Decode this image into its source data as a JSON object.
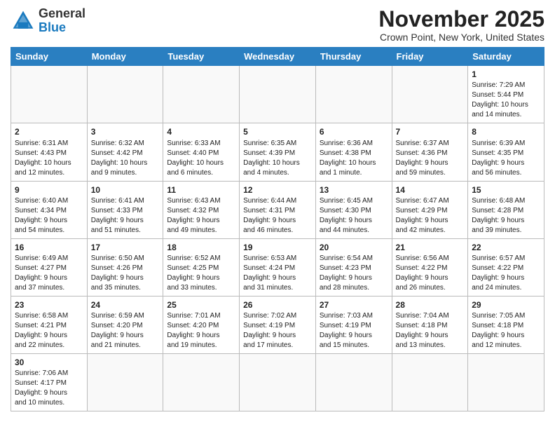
{
  "logo": {
    "text_general": "General",
    "text_blue": "Blue"
  },
  "title": {
    "month_year": "November 2025",
    "location": "Crown Point, New York, United States"
  },
  "weekdays": [
    "Sunday",
    "Monday",
    "Tuesday",
    "Wednesday",
    "Thursday",
    "Friday",
    "Saturday"
  ],
  "weeks": [
    [
      {
        "day": "",
        "info": ""
      },
      {
        "day": "",
        "info": ""
      },
      {
        "day": "",
        "info": ""
      },
      {
        "day": "",
        "info": ""
      },
      {
        "day": "",
        "info": ""
      },
      {
        "day": "",
        "info": ""
      },
      {
        "day": "1",
        "info": "Sunrise: 7:29 AM\nSunset: 5:44 PM\nDaylight: 10 hours\nand 14 minutes."
      }
    ],
    [
      {
        "day": "2",
        "info": "Sunrise: 6:31 AM\nSunset: 4:43 PM\nDaylight: 10 hours\nand 12 minutes."
      },
      {
        "day": "3",
        "info": "Sunrise: 6:32 AM\nSunset: 4:42 PM\nDaylight: 10 hours\nand 9 minutes."
      },
      {
        "day": "4",
        "info": "Sunrise: 6:33 AM\nSunset: 4:40 PM\nDaylight: 10 hours\nand 6 minutes."
      },
      {
        "day": "5",
        "info": "Sunrise: 6:35 AM\nSunset: 4:39 PM\nDaylight: 10 hours\nand 4 minutes."
      },
      {
        "day": "6",
        "info": "Sunrise: 6:36 AM\nSunset: 4:38 PM\nDaylight: 10 hours\nand 1 minute."
      },
      {
        "day": "7",
        "info": "Sunrise: 6:37 AM\nSunset: 4:36 PM\nDaylight: 9 hours\nand 59 minutes."
      },
      {
        "day": "8",
        "info": "Sunrise: 6:39 AM\nSunset: 4:35 PM\nDaylight: 9 hours\nand 56 minutes."
      }
    ],
    [
      {
        "day": "9",
        "info": "Sunrise: 6:40 AM\nSunset: 4:34 PM\nDaylight: 9 hours\nand 54 minutes."
      },
      {
        "day": "10",
        "info": "Sunrise: 6:41 AM\nSunset: 4:33 PM\nDaylight: 9 hours\nand 51 minutes."
      },
      {
        "day": "11",
        "info": "Sunrise: 6:43 AM\nSunset: 4:32 PM\nDaylight: 9 hours\nand 49 minutes."
      },
      {
        "day": "12",
        "info": "Sunrise: 6:44 AM\nSunset: 4:31 PM\nDaylight: 9 hours\nand 46 minutes."
      },
      {
        "day": "13",
        "info": "Sunrise: 6:45 AM\nSunset: 4:30 PM\nDaylight: 9 hours\nand 44 minutes."
      },
      {
        "day": "14",
        "info": "Sunrise: 6:47 AM\nSunset: 4:29 PM\nDaylight: 9 hours\nand 42 minutes."
      },
      {
        "day": "15",
        "info": "Sunrise: 6:48 AM\nSunset: 4:28 PM\nDaylight: 9 hours\nand 39 minutes."
      }
    ],
    [
      {
        "day": "16",
        "info": "Sunrise: 6:49 AM\nSunset: 4:27 PM\nDaylight: 9 hours\nand 37 minutes."
      },
      {
        "day": "17",
        "info": "Sunrise: 6:50 AM\nSunset: 4:26 PM\nDaylight: 9 hours\nand 35 minutes."
      },
      {
        "day": "18",
        "info": "Sunrise: 6:52 AM\nSunset: 4:25 PM\nDaylight: 9 hours\nand 33 minutes."
      },
      {
        "day": "19",
        "info": "Sunrise: 6:53 AM\nSunset: 4:24 PM\nDaylight: 9 hours\nand 31 minutes."
      },
      {
        "day": "20",
        "info": "Sunrise: 6:54 AM\nSunset: 4:23 PM\nDaylight: 9 hours\nand 28 minutes."
      },
      {
        "day": "21",
        "info": "Sunrise: 6:56 AM\nSunset: 4:22 PM\nDaylight: 9 hours\nand 26 minutes."
      },
      {
        "day": "22",
        "info": "Sunrise: 6:57 AM\nSunset: 4:22 PM\nDaylight: 9 hours\nand 24 minutes."
      }
    ],
    [
      {
        "day": "23",
        "info": "Sunrise: 6:58 AM\nSunset: 4:21 PM\nDaylight: 9 hours\nand 22 minutes."
      },
      {
        "day": "24",
        "info": "Sunrise: 6:59 AM\nSunset: 4:20 PM\nDaylight: 9 hours\nand 21 minutes."
      },
      {
        "day": "25",
        "info": "Sunrise: 7:01 AM\nSunset: 4:20 PM\nDaylight: 9 hours\nand 19 minutes."
      },
      {
        "day": "26",
        "info": "Sunrise: 7:02 AM\nSunset: 4:19 PM\nDaylight: 9 hours\nand 17 minutes."
      },
      {
        "day": "27",
        "info": "Sunrise: 7:03 AM\nSunset: 4:19 PM\nDaylight: 9 hours\nand 15 minutes."
      },
      {
        "day": "28",
        "info": "Sunrise: 7:04 AM\nSunset: 4:18 PM\nDaylight: 9 hours\nand 13 minutes."
      },
      {
        "day": "29",
        "info": "Sunrise: 7:05 AM\nSunset: 4:18 PM\nDaylight: 9 hours\nand 12 minutes."
      }
    ],
    [
      {
        "day": "30",
        "info": "Sunrise: 7:06 AM\nSunset: 4:17 PM\nDaylight: 9 hours\nand 10 minutes."
      },
      {
        "day": "",
        "info": ""
      },
      {
        "day": "",
        "info": ""
      },
      {
        "day": "",
        "info": ""
      },
      {
        "day": "",
        "info": ""
      },
      {
        "day": "",
        "info": ""
      },
      {
        "day": "",
        "info": ""
      }
    ]
  ]
}
